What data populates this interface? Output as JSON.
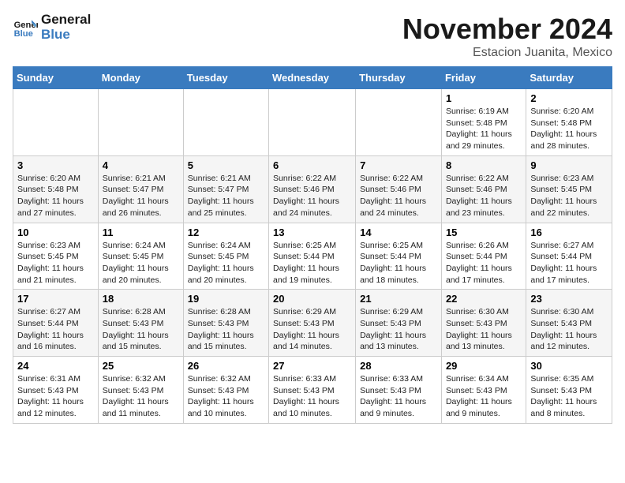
{
  "logo": {
    "line1": "General",
    "line2": "Blue"
  },
  "title": "November 2024",
  "location": "Estacion Juanita, Mexico",
  "weekdays": [
    "Sunday",
    "Monday",
    "Tuesday",
    "Wednesday",
    "Thursday",
    "Friday",
    "Saturday"
  ],
  "weeks": [
    [
      {
        "day": "",
        "info": ""
      },
      {
        "day": "",
        "info": ""
      },
      {
        "day": "",
        "info": ""
      },
      {
        "day": "",
        "info": ""
      },
      {
        "day": "",
        "info": ""
      },
      {
        "day": "1",
        "info": "Sunrise: 6:19 AM\nSunset: 5:48 PM\nDaylight: 11 hours and 29 minutes."
      },
      {
        "day": "2",
        "info": "Sunrise: 6:20 AM\nSunset: 5:48 PM\nDaylight: 11 hours and 28 minutes."
      }
    ],
    [
      {
        "day": "3",
        "info": "Sunrise: 6:20 AM\nSunset: 5:48 PM\nDaylight: 11 hours and 27 minutes."
      },
      {
        "day": "4",
        "info": "Sunrise: 6:21 AM\nSunset: 5:47 PM\nDaylight: 11 hours and 26 minutes."
      },
      {
        "day": "5",
        "info": "Sunrise: 6:21 AM\nSunset: 5:47 PM\nDaylight: 11 hours and 25 minutes."
      },
      {
        "day": "6",
        "info": "Sunrise: 6:22 AM\nSunset: 5:46 PM\nDaylight: 11 hours and 24 minutes."
      },
      {
        "day": "7",
        "info": "Sunrise: 6:22 AM\nSunset: 5:46 PM\nDaylight: 11 hours and 24 minutes."
      },
      {
        "day": "8",
        "info": "Sunrise: 6:22 AM\nSunset: 5:46 PM\nDaylight: 11 hours and 23 minutes."
      },
      {
        "day": "9",
        "info": "Sunrise: 6:23 AM\nSunset: 5:45 PM\nDaylight: 11 hours and 22 minutes."
      }
    ],
    [
      {
        "day": "10",
        "info": "Sunrise: 6:23 AM\nSunset: 5:45 PM\nDaylight: 11 hours and 21 minutes."
      },
      {
        "day": "11",
        "info": "Sunrise: 6:24 AM\nSunset: 5:45 PM\nDaylight: 11 hours and 20 minutes."
      },
      {
        "day": "12",
        "info": "Sunrise: 6:24 AM\nSunset: 5:45 PM\nDaylight: 11 hours and 20 minutes."
      },
      {
        "day": "13",
        "info": "Sunrise: 6:25 AM\nSunset: 5:44 PM\nDaylight: 11 hours and 19 minutes."
      },
      {
        "day": "14",
        "info": "Sunrise: 6:25 AM\nSunset: 5:44 PM\nDaylight: 11 hours and 18 minutes."
      },
      {
        "day": "15",
        "info": "Sunrise: 6:26 AM\nSunset: 5:44 PM\nDaylight: 11 hours and 17 minutes."
      },
      {
        "day": "16",
        "info": "Sunrise: 6:27 AM\nSunset: 5:44 PM\nDaylight: 11 hours and 17 minutes."
      }
    ],
    [
      {
        "day": "17",
        "info": "Sunrise: 6:27 AM\nSunset: 5:44 PM\nDaylight: 11 hours and 16 minutes."
      },
      {
        "day": "18",
        "info": "Sunrise: 6:28 AM\nSunset: 5:43 PM\nDaylight: 11 hours and 15 minutes."
      },
      {
        "day": "19",
        "info": "Sunrise: 6:28 AM\nSunset: 5:43 PM\nDaylight: 11 hours and 15 minutes."
      },
      {
        "day": "20",
        "info": "Sunrise: 6:29 AM\nSunset: 5:43 PM\nDaylight: 11 hours and 14 minutes."
      },
      {
        "day": "21",
        "info": "Sunrise: 6:29 AM\nSunset: 5:43 PM\nDaylight: 11 hours and 13 minutes."
      },
      {
        "day": "22",
        "info": "Sunrise: 6:30 AM\nSunset: 5:43 PM\nDaylight: 11 hours and 13 minutes."
      },
      {
        "day": "23",
        "info": "Sunrise: 6:30 AM\nSunset: 5:43 PM\nDaylight: 11 hours and 12 minutes."
      }
    ],
    [
      {
        "day": "24",
        "info": "Sunrise: 6:31 AM\nSunset: 5:43 PM\nDaylight: 11 hours and 12 minutes."
      },
      {
        "day": "25",
        "info": "Sunrise: 6:32 AM\nSunset: 5:43 PM\nDaylight: 11 hours and 11 minutes."
      },
      {
        "day": "26",
        "info": "Sunrise: 6:32 AM\nSunset: 5:43 PM\nDaylight: 11 hours and 10 minutes."
      },
      {
        "day": "27",
        "info": "Sunrise: 6:33 AM\nSunset: 5:43 PM\nDaylight: 11 hours and 10 minutes."
      },
      {
        "day": "28",
        "info": "Sunrise: 6:33 AM\nSunset: 5:43 PM\nDaylight: 11 hours and 9 minutes."
      },
      {
        "day": "29",
        "info": "Sunrise: 6:34 AM\nSunset: 5:43 PM\nDaylight: 11 hours and 9 minutes."
      },
      {
        "day": "30",
        "info": "Sunrise: 6:35 AM\nSunset: 5:43 PM\nDaylight: 11 hours and 8 minutes."
      }
    ]
  ]
}
